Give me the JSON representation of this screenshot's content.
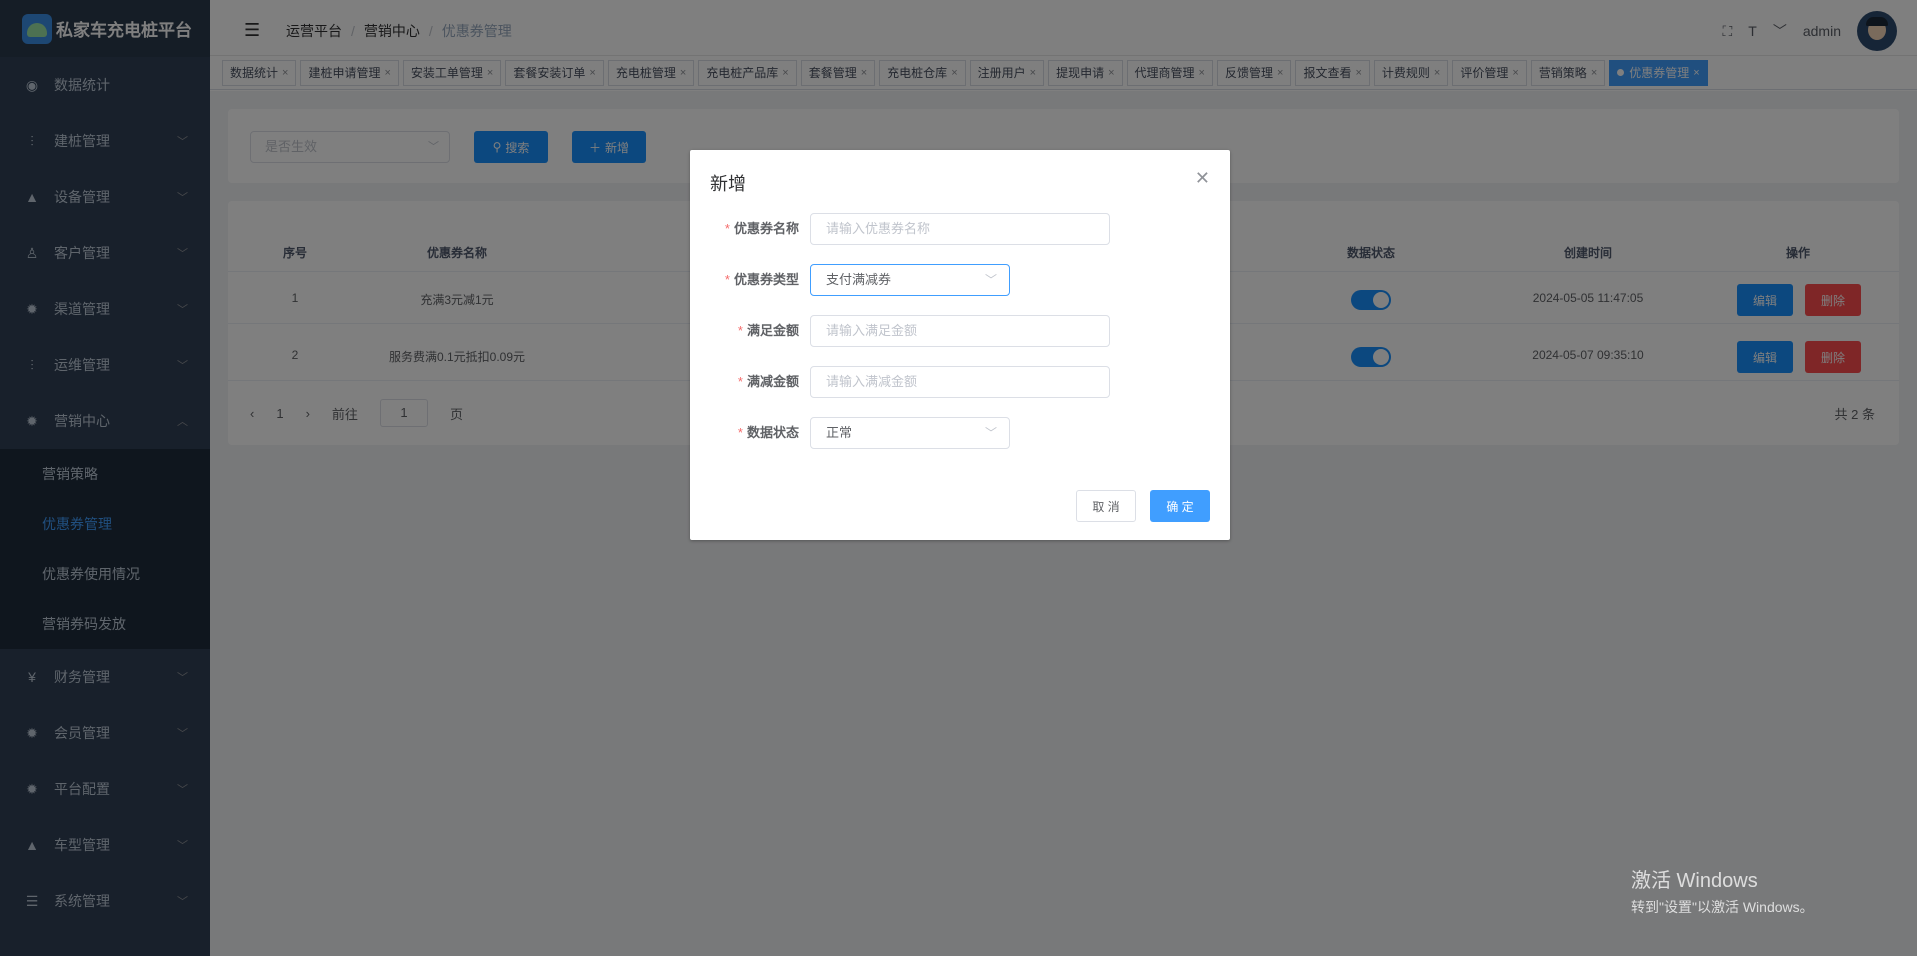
{
  "app": {
    "logo_text": "私家车充电桩平台"
  },
  "sidebar": {
    "items": [
      {
        "label": "数据统计",
        "icon": "dashboard-icon"
      },
      {
        "label": "建桩管理",
        "icon": "chart-icon"
      },
      {
        "label": "设备管理",
        "icon": "device-icon"
      },
      {
        "label": "客户管理",
        "icon": "user-icon"
      },
      {
        "label": "渠道管理",
        "icon": "gear-icon"
      },
      {
        "label": "运维管理",
        "icon": "chart-icon"
      },
      {
        "label": "营销中心",
        "icon": "gear-icon"
      }
    ],
    "sub_items": [
      {
        "label": "营销策略"
      },
      {
        "label": "优惠券管理"
      },
      {
        "label": "优惠券使用情况"
      },
      {
        "label": "营销券码发放"
      }
    ],
    "items_after": [
      {
        "label": "财务管理",
        "icon": "money-icon"
      },
      {
        "label": "会员管理",
        "icon": "gear-icon"
      },
      {
        "label": "平台配置",
        "icon": "gear-icon"
      },
      {
        "label": "车型管理",
        "icon": "device-icon"
      },
      {
        "label": "系统管理",
        "icon": "list-icon"
      }
    ]
  },
  "navbar": {
    "breadcrumb": [
      "运营平台",
      "营销中心",
      "优惠券管理"
    ],
    "user": "admin"
  },
  "tags": [
    "数据统计",
    "建桩申请管理",
    "安装工单管理",
    "套餐安装订单",
    "充电桩管理",
    "充电桩产品库",
    "套餐管理",
    "充电桩仓库",
    "注册用户",
    "提现申请",
    "代理商管理",
    "反馈管理",
    "报文查看",
    "计费规则",
    "评价管理",
    "营销策略",
    "优惠券管理"
  ],
  "filter": {
    "select_placeholder": "是否生效",
    "search_label": "搜索",
    "add_label": "新增"
  },
  "table": {
    "headers": [
      "序号",
      "优惠券名称",
      "数据状态",
      "创建时间",
      "操作"
    ],
    "rows": [
      {
        "index": "1",
        "name": "充满3元减1元",
        "created": "2024-05-05 11:47:05",
        "status_on": true
      },
      {
        "index": "2",
        "name": "服务费满0.1元抵扣0.09元",
        "created": "2024-05-07 09:35:10",
        "status_on": true
      }
    ],
    "edit_label": "编辑",
    "delete_label": "删除"
  },
  "pager": {
    "page": "1",
    "goto_label": "前往",
    "goto_value": "1",
    "page_unit": "页",
    "total": "共 2 条"
  },
  "dialog": {
    "title": "新增",
    "fields": [
      {
        "label": "优惠券名称",
        "placeholder": "请输入优惠券名称"
      },
      {
        "label": "优惠券类型",
        "value": "支付满减券"
      },
      {
        "label": "满足金额",
        "placeholder": "请输入满足金额"
      },
      {
        "label": "满减金额",
        "placeholder": "请输入满减金额"
      },
      {
        "label": "数据状态",
        "value": "正常"
      }
    ],
    "cancel_label": "取 消",
    "ok_label": "确 定"
  },
  "watermark": {
    "line1": "激活 Windows",
    "line2": "转到\"设置\"以激活 Windows。"
  },
  "colors": {
    "primary": "#1890ff",
    "danger": "#ff4d4f",
    "sidebar_bg": "#304156"
  }
}
